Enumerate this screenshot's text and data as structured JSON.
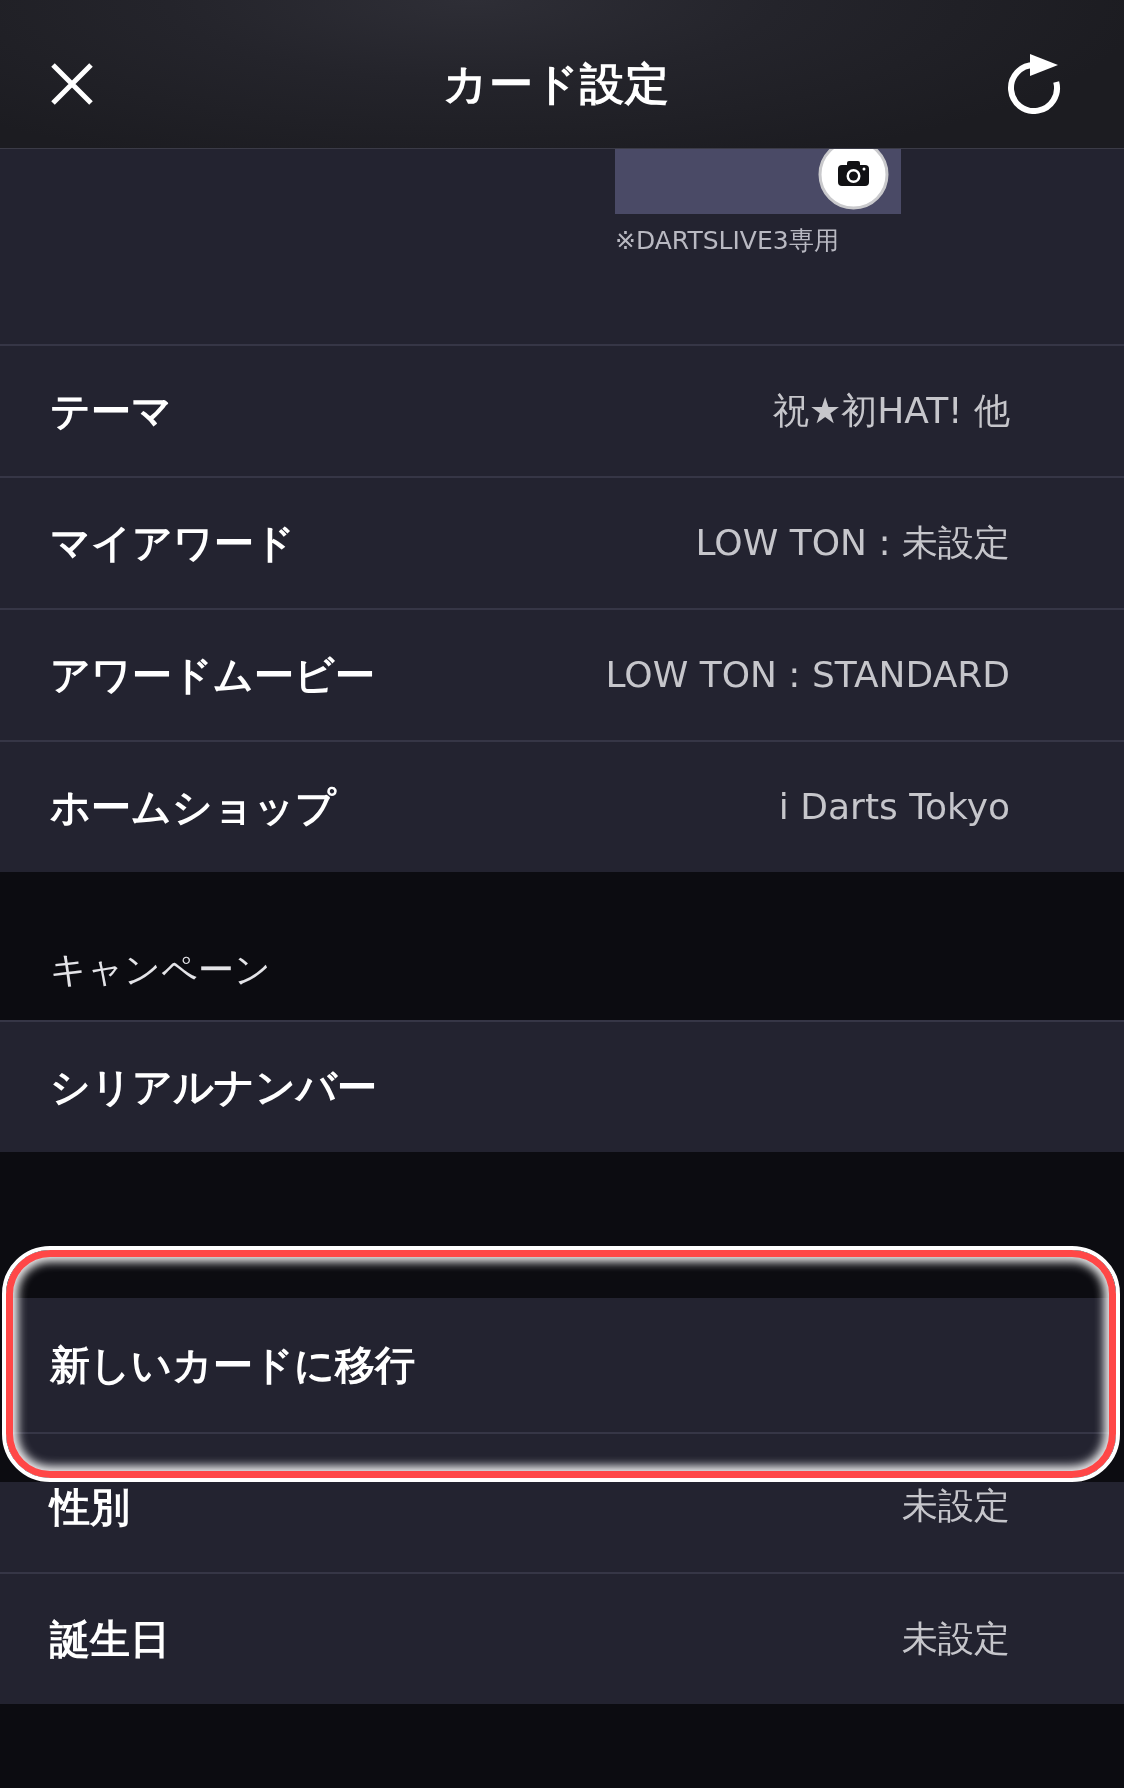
{
  "header": {
    "title": "カード設定"
  },
  "card": {
    "note": "※DARTSLIVE3専用"
  },
  "settings": [
    {
      "label": "テーマ",
      "value": "祝★初HAT! 他"
    },
    {
      "label": "マイアワード",
      "value": "LOW TON : 未設定"
    },
    {
      "label": "アワードムービー",
      "value": "LOW TON : STANDARD"
    },
    {
      "label": "ホームショップ",
      "value": "i Darts Tokyo"
    }
  ],
  "campaign": {
    "title": "キャンペーン",
    "items": [
      {
        "label": "シリアルナンバー"
      }
    ]
  },
  "member": {
    "items": [
      {
        "label": "新しいカードに移行",
        "highlighted": true
      },
      {
        "label": "性別",
        "value": "未設定",
        "highlighted": false
      },
      {
        "label": "誕生日",
        "value": "未設定",
        "highlighted": false
      }
    ]
  }
}
